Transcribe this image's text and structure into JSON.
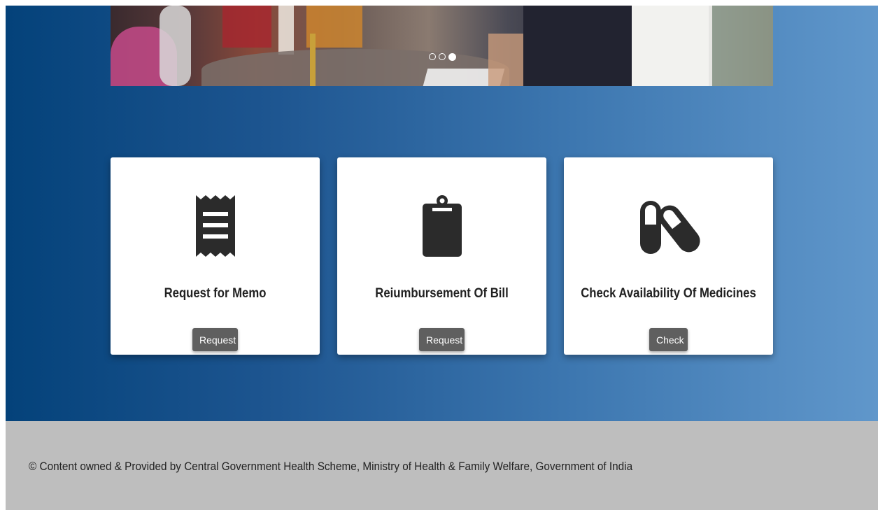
{
  "carousel": {
    "slide_count": 3,
    "active_index": 2
  },
  "cards": [
    {
      "icon": "receipt-icon",
      "title": "Request for Memo",
      "button_label": "Request"
    },
    {
      "icon": "clipboard-icon",
      "title": "Reiumbursement Of Bill",
      "button_label": "Request"
    },
    {
      "icon": "pills-icon",
      "title": "Check Availability Of Medicines",
      "button_label": "Check"
    }
  ],
  "footer": {
    "text": "© Content owned & Provided by Central Government Health Scheme, Ministry of Health & Family Welfare, Government of India"
  },
  "colors": {
    "hero_gradient_start": "#04427a",
    "hero_gradient_end": "#6097cb",
    "button_bg": "#5f5f5f",
    "footer_bg": "#bebebe",
    "icon_color": "#2b2b2b"
  }
}
